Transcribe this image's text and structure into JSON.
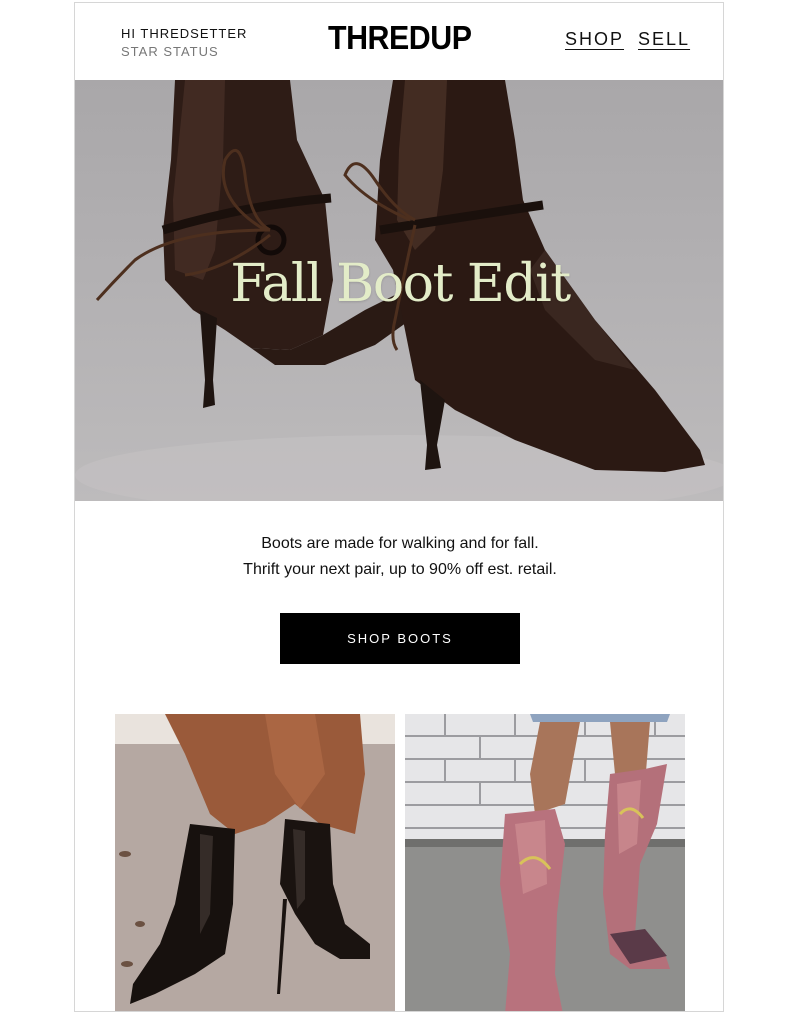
{
  "header": {
    "greeting": "HI THREDSETTER",
    "status": "STAR STATUS",
    "logo": "THREDUP",
    "nav": [
      {
        "label": "SHOP"
      },
      {
        "label": "SELL"
      }
    ]
  },
  "hero": {
    "title": "Fall Boot Edit",
    "title_color": "#e3ecc8"
  },
  "body": {
    "line1": "Boots are made for walking and for fall.",
    "line2": "Thrift your next pair, up to 90% off est. retail."
  },
  "cta": {
    "label": "SHOP BOOTS"
  },
  "colors": {
    "cta_background": "#000000",
    "cta_text": "#ffffff"
  }
}
